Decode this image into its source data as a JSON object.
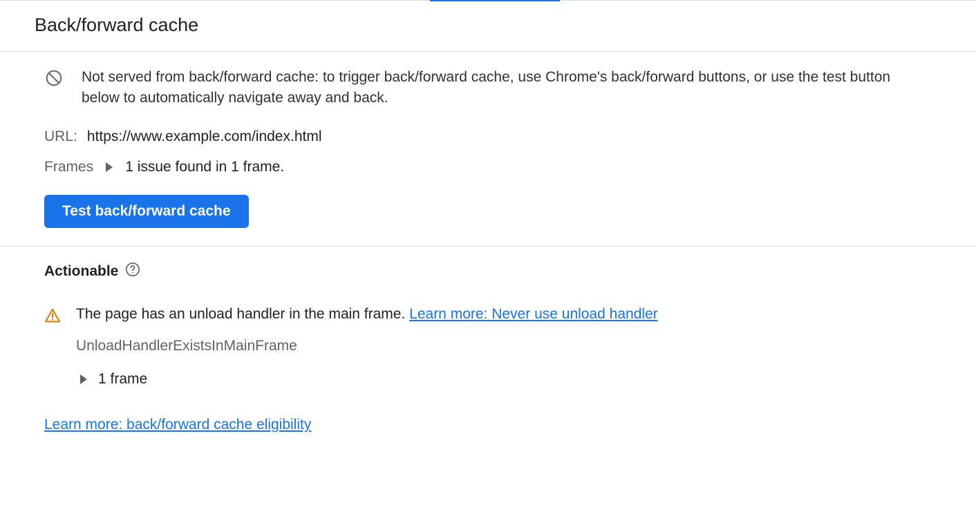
{
  "header": {
    "title": "Back/forward cache"
  },
  "info": {
    "message": "Not served from back/forward cache: to trigger back/forward cache, use Chrome's back/forward buttons, or use the test button below to automatically navigate away and back."
  },
  "url": {
    "label": "URL:",
    "value": "https://www.example.com/index.html"
  },
  "frames": {
    "label": "Frames",
    "summary": "1 issue found in 1 frame."
  },
  "buttons": {
    "test": "Test back/forward cache"
  },
  "actionable": {
    "heading": "Actionable",
    "issue": {
      "message": "The page has an unload handler in the main frame. ",
      "learn_more": "Learn more: Never use unload handler",
      "reason_code": "UnloadHandlerExistsInMainFrame",
      "frame_summary": "1 frame"
    }
  },
  "footer": {
    "eligibility_link": "Learn more: back/forward cache eligibility"
  }
}
